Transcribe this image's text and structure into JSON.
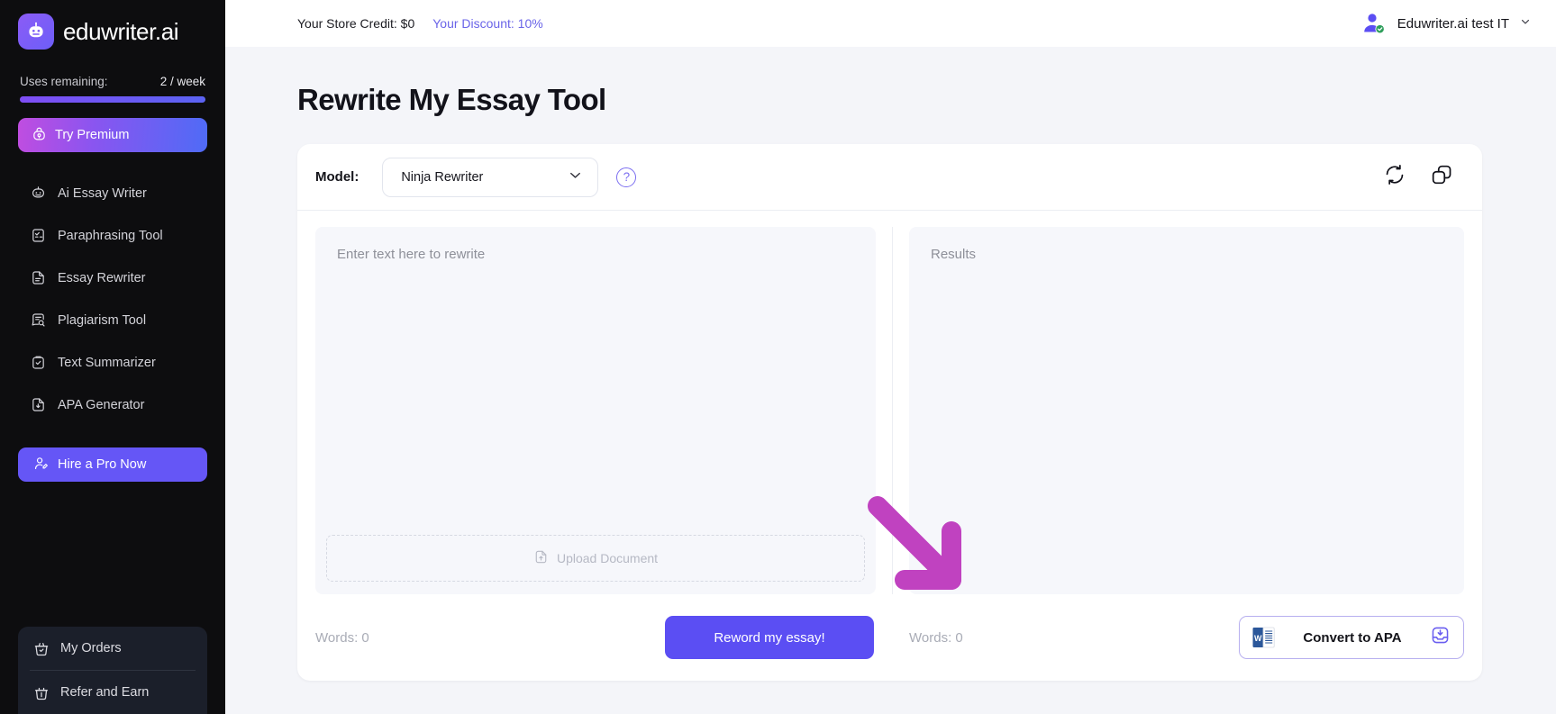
{
  "brand": {
    "name": "eduwriter.ai",
    "logo_icon": "robot-icon"
  },
  "sidebar": {
    "uses_label": "Uses remaining:",
    "uses_value": "2 / week",
    "progress_percent": 100,
    "try_premium": {
      "label": "Try Premium",
      "icon": "lock-icon"
    },
    "items": [
      {
        "label": "Ai Essay Writer",
        "icon": "robot-icon"
      },
      {
        "label": "Paraphrasing Tool",
        "icon": "document-check-icon"
      },
      {
        "label": "Essay Rewriter",
        "icon": "document-lines-icon"
      },
      {
        "label": "Plagiarism Tool",
        "icon": "document-search-icon"
      },
      {
        "label": "Text Summarizer",
        "icon": "clipboard-check-icon"
      },
      {
        "label": "APA Generator",
        "icon": "document-download-icon"
      }
    ],
    "hire_pro": {
      "label": "Hire a Pro Now",
      "icon": "user-edit-icon"
    },
    "bottom_items": [
      {
        "label": "My Orders",
        "icon": "basket-check-icon"
      },
      {
        "label": "Refer and Earn",
        "icon": "basket-gift-icon"
      }
    ]
  },
  "topbar": {
    "store_credit": "Your Store Credit: $0",
    "discount": "Your Discount: 10%",
    "account_name": "Eduwriter.ai test IT",
    "avatar_icon": "user-verified-icon",
    "chevron_icon": "chevron-down-icon"
  },
  "page": {
    "title": "Rewrite My Essay Tool"
  },
  "tool": {
    "model_label": "Model:",
    "model_value": "Ninja Rewriter",
    "model_chevron_icon": "chevron-down-icon",
    "help_label": "?",
    "refresh_icon": "refresh-icon",
    "copy_icon": "copy-icon",
    "input_placeholder": "Enter text here to rewrite",
    "input_value": "",
    "results_placeholder": "Results",
    "results_value": "",
    "upload_label": "Upload Document",
    "upload_icon": "file-upload-icon",
    "input_words": "Words: 0",
    "output_words": "Words: 0",
    "reword_button": "Reword my essay!",
    "convert_button": "Convert to APA",
    "word_doc_icon": "word-document-icon",
    "download_icon": "download-box-icon"
  },
  "annotation": {
    "arrow_icon": "arrow-down-right-icon",
    "color": "#c042c0"
  },
  "colors": {
    "sidebar_bg": "#0d0d0f",
    "accent_purple": "#5b4ef3",
    "discount_purple": "#6a64e8",
    "page_bg": "#f4f5f9",
    "annotation_pink": "#c042c0"
  }
}
